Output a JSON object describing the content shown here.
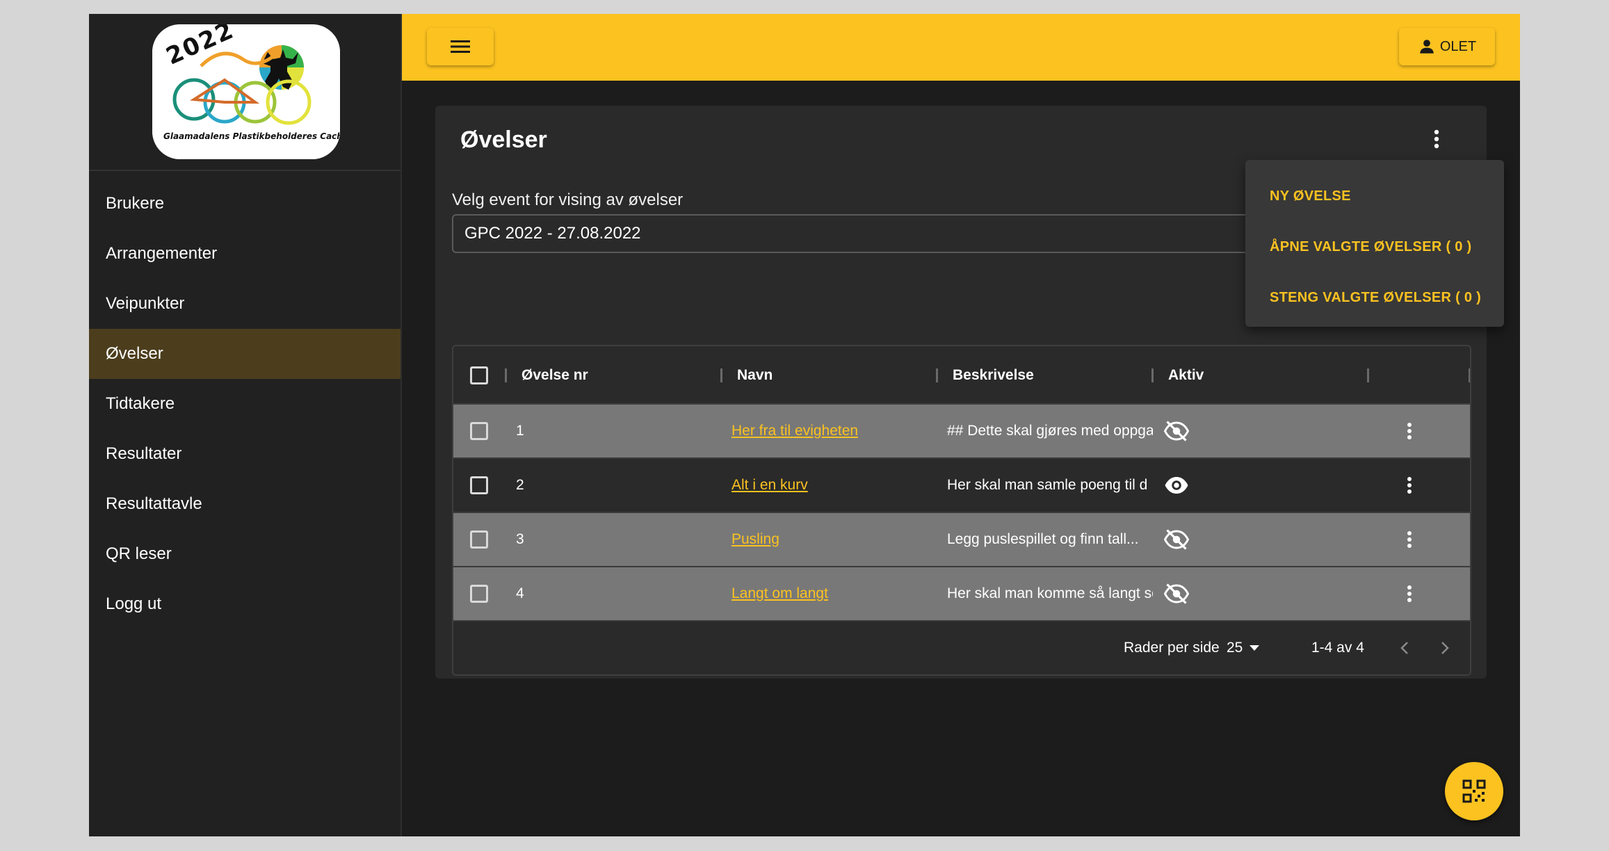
{
  "logo": {
    "year": "2022",
    "caption": "Glaamadalens Plastikbeholderes Cachelekar"
  },
  "sidebar": {
    "items": [
      {
        "label": "Brukere",
        "active": false
      },
      {
        "label": "Arrangementer",
        "active": false
      },
      {
        "label": "Veipunkter",
        "active": false
      },
      {
        "label": "Øvelser",
        "active": true
      },
      {
        "label": "Tidtakere",
        "active": false
      },
      {
        "label": "Resultater",
        "active": false
      },
      {
        "label": "Resultattavle",
        "active": false
      },
      {
        "label": "QR leser",
        "active": false
      },
      {
        "label": "Logg ut",
        "active": false
      }
    ]
  },
  "topbar": {
    "menu_icon": "hamburger-icon",
    "user_label": "OLET",
    "user_icon": "person-icon",
    "accent_color": "#fbc220"
  },
  "page": {
    "title": "Øvelser",
    "event_select_label": "Velg event for vising av øvelser",
    "event_select_value": "GPC 2022 - 27.08.2022"
  },
  "dropdown": {
    "items": [
      {
        "label": "NY ØVELSE"
      },
      {
        "label": "ÅPNE VALGTE ØVELSER ( 0 )"
      },
      {
        "label": "STENG VALGTE ØVELSER ( 0 )"
      }
    ]
  },
  "table": {
    "columns": [
      "Øvelse nr",
      "Navn",
      "Beskrivelse",
      "Aktiv"
    ],
    "rows": [
      {
        "nr": "1",
        "name": "Her fra til evigheten",
        "description": "## Dette skal gjøres med oppgave",
        "active": false,
        "shade": "grey"
      },
      {
        "nr": "2",
        "name": "Alt i en kurv",
        "description": "Her skal man samle poeng til d",
        "active": true,
        "shade": "dark"
      },
      {
        "nr": "3",
        "name": "Pusling",
        "description": "Legg puslespillet og finn tall...",
        "active": false,
        "shade": "grey"
      },
      {
        "nr": "4",
        "name": "Langt om langt",
        "description": "Her skal man komme så langt som",
        "active": false,
        "shade": "grey"
      }
    ],
    "footer": {
      "rows_per_page_label": "Rader per side",
      "rows_per_page_value": "25",
      "range_label": "1-4 av 4"
    }
  },
  "fab": {
    "icon": "qr-code-icon"
  }
}
